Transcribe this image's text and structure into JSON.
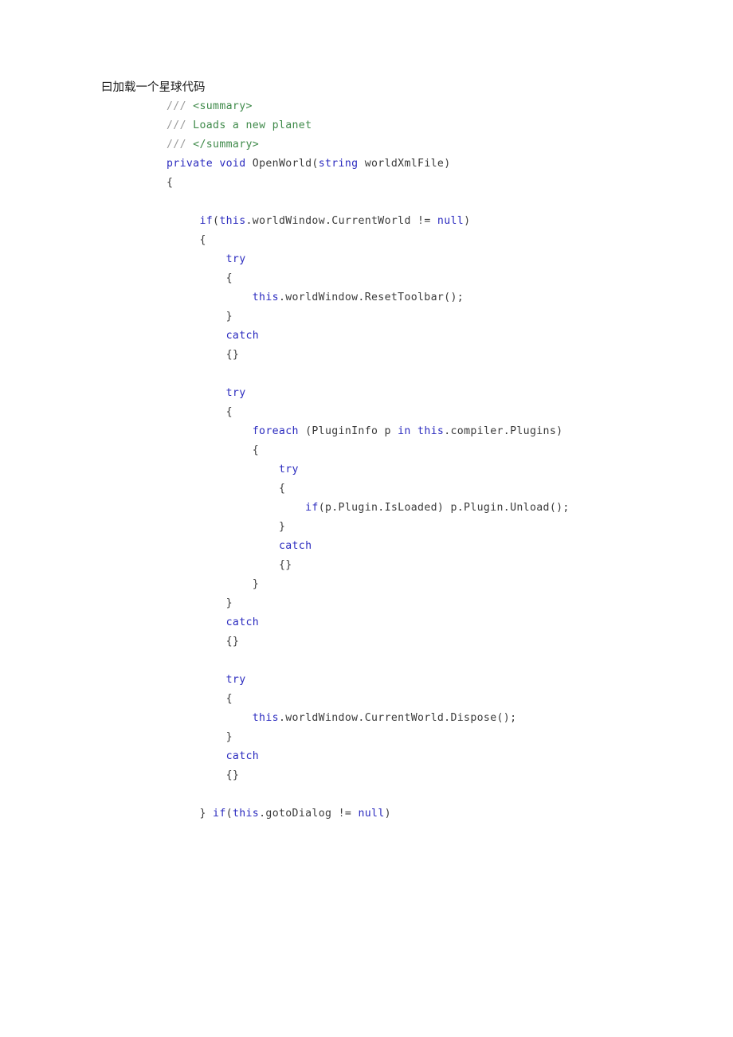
{
  "document": {
    "heading": "曰加载一个星球代码",
    "background_color": "#ffffff",
    "colors": {
      "keyword": "#2b2bbf",
      "comment": "#3f8a4a",
      "comment_slash": "#9a9a9a",
      "plain": "#3a3a3a",
      "heading": "#1a1a1a"
    },
    "language": "C#"
  },
  "code": {
    "lines": [
      {
        "indent": 0,
        "tokens": [
          {
            "t": "cmt-slash",
            "v": "/// "
          },
          {
            "t": "cmt",
            "v": "<summary>"
          }
        ]
      },
      {
        "indent": 0,
        "tokens": [
          {
            "t": "cmt-slash",
            "v": "/// "
          },
          {
            "t": "cmt",
            "v": "Loads a new planet"
          }
        ]
      },
      {
        "indent": 0,
        "tokens": [
          {
            "t": "cmt-slash",
            "v": "/// "
          },
          {
            "t": "cmt",
            "v": "</summary>"
          }
        ]
      },
      {
        "indent": 0,
        "tokens": [
          {
            "t": "kw",
            "v": "private"
          },
          {
            "t": "pl",
            "v": " "
          },
          {
            "t": "kw",
            "v": "void"
          },
          {
            "t": "pl",
            "v": " OpenWorld("
          },
          {
            "t": "kw",
            "v": "string"
          },
          {
            "t": "pl",
            "v": " worldXmlFile)"
          }
        ]
      },
      {
        "indent": 0,
        "tokens": [
          {
            "t": "pl",
            "v": "{"
          }
        ]
      },
      {
        "indent": 0,
        "tokens": [
          {
            "t": "pl",
            "v": ""
          }
        ]
      },
      {
        "indent": 5,
        "tokens": [
          {
            "t": "kw",
            "v": "if"
          },
          {
            "t": "pl",
            "v": "("
          },
          {
            "t": "kw",
            "v": "this"
          },
          {
            "t": "pl",
            "v": ".worldWindow.CurrentWorld != "
          },
          {
            "t": "kw",
            "v": "null"
          },
          {
            "t": "pl",
            "v": ")"
          }
        ]
      },
      {
        "indent": 5,
        "tokens": [
          {
            "t": "pl",
            "v": "{"
          }
        ]
      },
      {
        "indent": 9,
        "tokens": [
          {
            "t": "kw",
            "v": "try"
          }
        ]
      },
      {
        "indent": 9,
        "tokens": [
          {
            "t": "pl",
            "v": "{"
          }
        ]
      },
      {
        "indent": 13,
        "tokens": [
          {
            "t": "kw",
            "v": "this"
          },
          {
            "t": "pl",
            "v": ".worldWindow.ResetToolbar();"
          }
        ]
      },
      {
        "indent": 9,
        "tokens": [
          {
            "t": "pl",
            "v": "}"
          }
        ]
      },
      {
        "indent": 9,
        "tokens": [
          {
            "t": "kw",
            "v": "catch"
          }
        ]
      },
      {
        "indent": 9,
        "tokens": [
          {
            "t": "pl",
            "v": "{}"
          }
        ]
      },
      {
        "indent": 0,
        "tokens": [
          {
            "t": "pl",
            "v": ""
          }
        ]
      },
      {
        "indent": 9,
        "tokens": [
          {
            "t": "kw",
            "v": "try"
          }
        ]
      },
      {
        "indent": 9,
        "tokens": [
          {
            "t": "pl",
            "v": "{"
          }
        ]
      },
      {
        "indent": 13,
        "tokens": [
          {
            "t": "kw",
            "v": "foreach"
          },
          {
            "t": "pl",
            "v": " (PluginInfo p "
          },
          {
            "t": "kw",
            "v": "in"
          },
          {
            "t": "pl",
            "v": " "
          },
          {
            "t": "kw",
            "v": "this"
          },
          {
            "t": "pl",
            "v": ".compiler.Plugins)"
          }
        ]
      },
      {
        "indent": 13,
        "tokens": [
          {
            "t": "pl",
            "v": "{"
          }
        ]
      },
      {
        "indent": 17,
        "tokens": [
          {
            "t": "kw",
            "v": "try"
          }
        ]
      },
      {
        "indent": 17,
        "tokens": [
          {
            "t": "pl",
            "v": "{"
          }
        ]
      },
      {
        "indent": 21,
        "tokens": [
          {
            "t": "kw",
            "v": "if"
          },
          {
            "t": "pl",
            "v": "(p.Plugin.IsLoaded) p.Plugin.Unload();"
          }
        ]
      },
      {
        "indent": 17,
        "tokens": [
          {
            "t": "pl",
            "v": "}"
          }
        ]
      },
      {
        "indent": 17,
        "tokens": [
          {
            "t": "kw",
            "v": "catch"
          }
        ]
      },
      {
        "indent": 17,
        "tokens": [
          {
            "t": "pl",
            "v": "{}"
          }
        ]
      },
      {
        "indent": 13,
        "tokens": [
          {
            "t": "pl",
            "v": "}"
          }
        ]
      },
      {
        "indent": 9,
        "tokens": [
          {
            "t": "pl",
            "v": "}"
          }
        ]
      },
      {
        "indent": 9,
        "tokens": [
          {
            "t": "kw",
            "v": "catch"
          }
        ]
      },
      {
        "indent": 9,
        "tokens": [
          {
            "t": "pl",
            "v": "{}"
          }
        ]
      },
      {
        "indent": 0,
        "tokens": [
          {
            "t": "pl",
            "v": ""
          }
        ]
      },
      {
        "indent": 9,
        "tokens": [
          {
            "t": "kw",
            "v": "try"
          }
        ]
      },
      {
        "indent": 9,
        "tokens": [
          {
            "t": "pl",
            "v": "{"
          }
        ]
      },
      {
        "indent": 13,
        "tokens": [
          {
            "t": "kw",
            "v": "this"
          },
          {
            "t": "pl",
            "v": ".worldWindow.CurrentWorld.Dispose();"
          }
        ]
      },
      {
        "indent": 9,
        "tokens": [
          {
            "t": "pl",
            "v": "}"
          }
        ]
      },
      {
        "indent": 9,
        "tokens": [
          {
            "t": "kw",
            "v": "catch"
          }
        ]
      },
      {
        "indent": 9,
        "tokens": [
          {
            "t": "pl",
            "v": "{}"
          }
        ]
      },
      {
        "indent": 0,
        "tokens": [
          {
            "t": "pl",
            "v": ""
          }
        ]
      },
      {
        "indent": 5,
        "tokens": [
          {
            "t": "pl",
            "v": "} "
          },
          {
            "t": "kw",
            "v": "if"
          },
          {
            "t": "pl",
            "v": "("
          },
          {
            "t": "kw",
            "v": "this"
          },
          {
            "t": "pl",
            "v": ".gotoDialog != "
          },
          {
            "t": "kw",
            "v": "null"
          },
          {
            "t": "pl",
            "v": ")"
          }
        ]
      }
    ]
  }
}
